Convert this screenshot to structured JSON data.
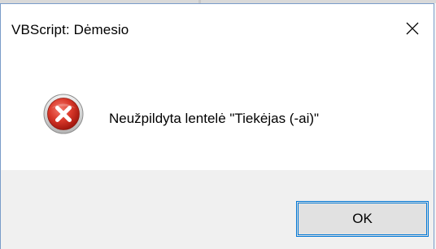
{
  "dialog": {
    "title": "VBScript: Dėmesio",
    "message": "Neužpildyta lentelė \"Tiekėjas (-ai)\"",
    "ok_label": "OK",
    "close_glyph": "✕",
    "icon": "error-icon"
  },
  "colors": {
    "border_accent": "#0078d7",
    "error_red": "#c42b1c",
    "footer_bg": "#f0f0f0"
  }
}
